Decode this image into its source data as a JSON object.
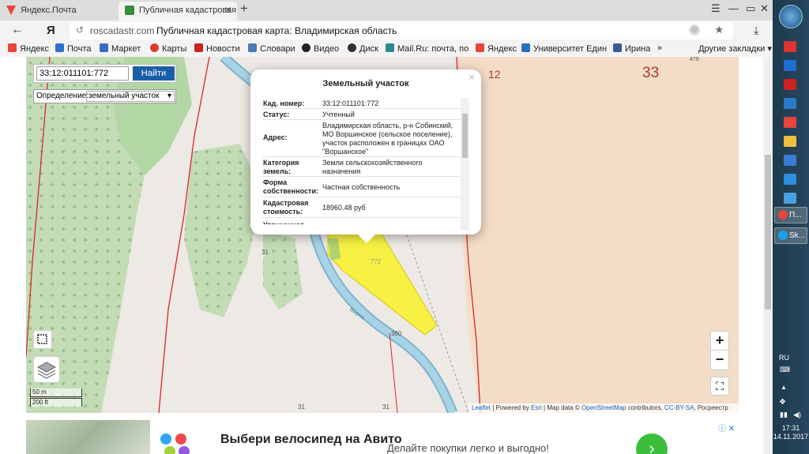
{
  "browser": {
    "tabs": [
      {
        "label": "Яндекс.Почта"
      },
      {
        "label": "Публичная кадастровая"
      }
    ],
    "url_domain": "roscadastr.com",
    "page_title": "Публичная кадастровая карта: Владимирская область",
    "bookmarks": [
      "Яндекс",
      "Почта",
      "Маркет",
      "Карты",
      "Новости",
      "Словари",
      "Видео",
      "Диск",
      "Mail.Ru: почта, по",
      "Яндекс",
      "Университет Един",
      "Ирина"
    ],
    "other_bookmarks": "Другие закладки"
  },
  "map": {
    "search_value": "33:12:011101:772",
    "search_button": "Найти",
    "definition_label": "Определение:",
    "definition_value": "земельный участок",
    "labels": {
      "quarter_12": "12",
      "region_33": "33",
      "n31a": "31",
      "n31b": "31",
      "n31c": "31",
      "n772": "772",
      "n360": "360",
      "river": "Вырна",
      "n479": "479"
    },
    "scale": {
      "metric": "50 m",
      "imperial": "200 ft"
    },
    "zoom_in": "+",
    "zoom_out": "−",
    "attribution": {
      "leaflet": "Leaflet",
      "powered": " | Powered by ",
      "esri": "Esri",
      "mapdata": " | Map data © ",
      "osm": "OpenStreetMap",
      "contrib": " contributors, ",
      "cc": "CC-BY-SA",
      "rosreestr": ", Росреестр"
    }
  },
  "popup": {
    "title": "Земельный участок",
    "rows": [
      {
        "key": "Кад. номер:",
        "value": "33:12:011101:772"
      },
      {
        "key": "Статус:",
        "value": "Учтенный"
      },
      {
        "key": "Адрес:",
        "value": "Владимирская область, р-н Собинский, МО Воршинское (сельское поселение), участок расположен в границах ОАО \"Воршанское\""
      },
      {
        "key": "Категория земель:",
        "value": "Земли сельскохозяйственного назначения"
      },
      {
        "key": "Форма собственности:",
        "value": "Частная собственность"
      },
      {
        "key": "Кадастровая стоимость:",
        "value": "18960.48 руб"
      },
      {
        "key": "Уточненная",
        "value": ""
      }
    ]
  },
  "ad": {
    "headline": "Выбери велосипед на Авито",
    "subtext": "Делайте покупки легко и выгодно!"
  },
  "taskbar": {
    "buttons": [
      "П...",
      "Sk..."
    ],
    "lang": "RU",
    "time": "17:31",
    "date": "14.11.2017"
  },
  "colors": {
    "parcel": "#f7f23a",
    "river": "#9ccbe0",
    "forest": "#b3d6a5",
    "boundary": "#d9252a"
  }
}
